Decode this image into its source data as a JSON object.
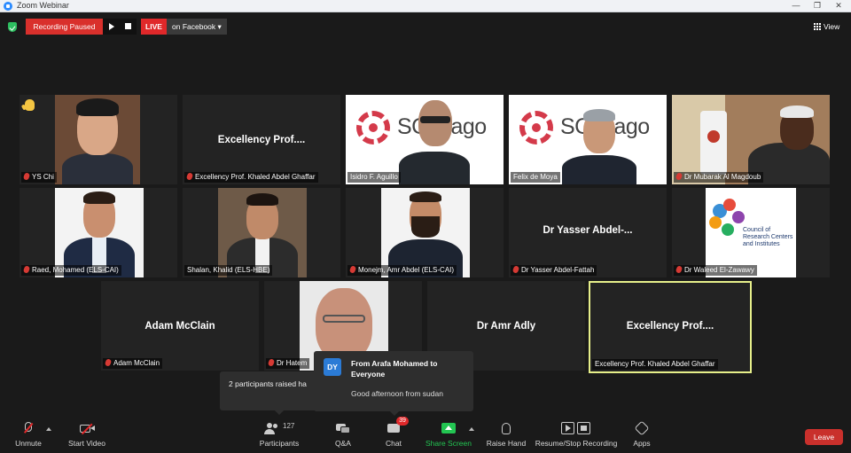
{
  "window": {
    "title": "Zoom Webinar",
    "minimize": "—",
    "restore": "❐",
    "close": "✕"
  },
  "topbar": {
    "recording_status": "Recording Paused",
    "live_label": "LIVE",
    "live_target": "on Facebook ▾",
    "view_label": "View"
  },
  "tiles": [
    {
      "name": "YS Chi",
      "big": "",
      "hand": true
    },
    {
      "name": "Excellency Prof. Khaled Abdel Ghaffar",
      "big": "Excellency  Prof...."
    },
    {
      "name": "Isidro F. Aguillo",
      "big": "",
      "logo_text": "SCImago"
    },
    {
      "name": "Felix de Moya",
      "big": "",
      "logo_text": "SCImago"
    },
    {
      "name": "Dr Mubarak Al Magdoub",
      "big": ""
    },
    {
      "name": "Raed, Mohamed (ELS-CAI)",
      "big": ""
    },
    {
      "name": "Shalan, Khalid (ELS-HBE)",
      "big": ""
    },
    {
      "name": "Monejm, Amr Abdel (ELS-CAI)",
      "big": ""
    },
    {
      "name": "Dr Yasser Abdel-Fattah",
      "big": "Dr Yasser Abdel-..."
    },
    {
      "name": "Dr Waleed El-Zawawy",
      "big": "",
      "logo_text": "Council of Research Centers and Institutes"
    },
    {
      "name": "Adam McClain",
      "big": "Adam McClain"
    },
    {
      "name": "Dr Hatem",
      "big": ""
    },
    {
      "name": "",
      "big": "Dr Amr Adly"
    },
    {
      "name": "Excellency Prof. Khaled Abdel Ghaffar",
      "big": "Excellency  Prof....",
      "active": true
    }
  ],
  "notifications": {
    "raised": "2 participants raised ha",
    "chat": {
      "initials": "DY",
      "from": "From Arafa Mohamed to Everyone",
      "message": "Good afternoon  from sudan"
    }
  },
  "toolbar": {
    "unmute": "Unmute",
    "start_video": "Start Video",
    "participants": "Participants",
    "participants_count": "127",
    "qa": "Q&A",
    "chat": "Chat",
    "chat_badge": "39",
    "share_screen": "Share Screen",
    "raise_hand": "Raise Hand",
    "recording": "Resume/Stop Recording",
    "apps": "Apps",
    "leave": "Leave"
  },
  "colors": {
    "share_green": "#23c552",
    "record_red": "#d9302c",
    "active_speaker": "#e6ef8a",
    "scimago_red": "#d43a4a"
  }
}
